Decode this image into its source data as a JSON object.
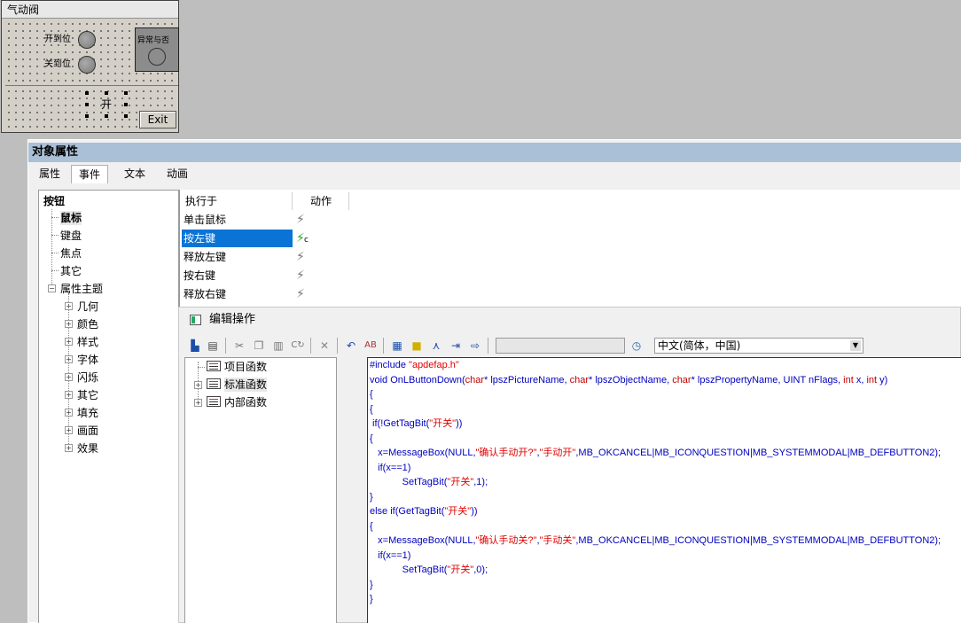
{
  "picture": {
    "title": "气动阀",
    "open_pos_label": "开到位",
    "close_pos_label": "关到位",
    "alarm_label": "异常与否",
    "open_button": "开",
    "exit_button": "Exit"
  },
  "dialog": {
    "title": "对象属性",
    "tabs": [
      "属性",
      "事件",
      "文本",
      "动画"
    ],
    "tree": {
      "root": "按钮",
      "items": [
        "鼠标",
        "键盘",
        "焦点",
        "其它"
      ],
      "theme": "属性主题",
      "theme_items": [
        "几何",
        "颜色",
        "样式",
        "字体",
        "闪烁",
        "其它",
        "填充",
        "画面",
        "效果"
      ]
    },
    "events": {
      "col_exec": "执行于",
      "col_action": "动作",
      "rows": [
        "单击鼠标",
        "按左键",
        "释放左键",
        "按右键",
        "释放右键"
      ],
      "action_suffix": "c"
    }
  },
  "editor": {
    "title": "编辑操作",
    "language": "中文(简体，中国)",
    "fn_tree": [
      "项目函数",
      "标准函数",
      "内部函数"
    ],
    "code": {
      "l1_pre": "#include ",
      "l1_str": "\"apdefap.h\"",
      "l2_a": "void OnLButtonDown(",
      "l2_b": "char",
      "l2_c": "* lpszPictureName, ",
      "l2_d": "char",
      "l2_e": "* lpszObjectName, ",
      "l2_f": "char",
      "l2_g": "* lpszPropertyName, UINT nFlags, ",
      "l2_h": "int",
      "l2_i": " x, ",
      "l2_j": "int",
      "l2_k": " y)",
      "l3": "{",
      "l4": "{",
      "l5_a": " if(!GetTagBit(",
      "l5_s": "\"开关\"",
      "l5_b": "))",
      "l6": "{",
      "l7_a": "   x=MessageBox(NULL,",
      "l7_s1": "\"确认手动开?\"",
      "l7_m": ",",
      "l7_s2": "\"手动开\"",
      "l7_b": ",MB_OKCANCEL|MB_ICONQUESTION|MB_SYSTEMMODAL|MB_DEFBUTTON2);",
      "l8": "   if(x==1)",
      "l9_a": "            SetTagBit(",
      "l9_s": "\"开关\"",
      "l9_b": ",1);",
      "l10": "}",
      "l11_a": "else if(GetTagBit(",
      "l11_s": "\"开关\"",
      "l11_b": "))",
      "l12": "{",
      "l13_a": "   x=MessageBox(NULL,",
      "l13_s1": "\"确认手动关?\"",
      "l13_m": ",",
      "l13_s2": "\"手动关\"",
      "l13_b": ",MB_OKCANCEL|MB_ICONQUESTION|MB_SYSTEMMODAL|MB_DEFBUTTON2);",
      "l14": "   if(x==1)",
      "l15_a": "            SetTagBit(",
      "l15_s": "\"开关\"",
      "l15_b": ",0);",
      "l16": "}",
      "l17": "}",
      "l18": "",
      "l19": "}"
    }
  }
}
